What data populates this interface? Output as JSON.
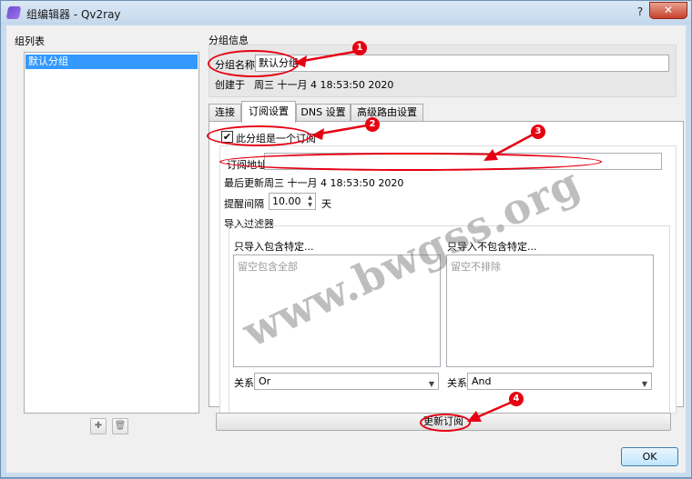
{
  "window": {
    "title": "组编辑器 - Qv2ray",
    "help_glyph": "?",
    "close_glyph": "✕"
  },
  "left": {
    "section_label": "组列表",
    "groups": [
      "默认分组"
    ],
    "add_icon": "✚",
    "delete_icon": "🗑"
  },
  "info": {
    "section_label": "分组信息",
    "name_label": "分组名称",
    "name_value": "默认分组",
    "created_label": "创建于",
    "created_value": "周三 十一月 4 18:53:50 2020"
  },
  "tabs": [
    "连接",
    "订阅设置",
    "DNS 设置",
    "高级路由设置"
  ],
  "subscription": {
    "is_subscription_label": "此分组是一个订阅",
    "checked": true,
    "check_glyph": "✔",
    "url_label": "订阅地址",
    "url_value": "",
    "last_update_label": "最后更新",
    "last_update_value": "周三 十一月 4 18:53:50 2020",
    "interval_label": "提醒间隔",
    "interval_value": "10.00",
    "interval_unit": "天",
    "spin_up": "▲",
    "spin_down": "▼",
    "filter_title": "导入过滤器",
    "include_label": "只导入包含特定...",
    "include_placeholder": "留空包含全部",
    "exclude_label": "只导入不包含特定...",
    "exclude_placeholder": "留空不排除",
    "relation_label": "关系",
    "include_relation": "Or",
    "exclude_relation": "And",
    "dropdown_glyph": "▼",
    "update_button": "更新订阅"
  },
  "footer": {
    "ok_button": "OK"
  },
  "annotations": {
    "badges": [
      "1",
      "2",
      "3",
      "4"
    ],
    "watermark": "www.bwgss.org",
    "color": "#e60012"
  }
}
